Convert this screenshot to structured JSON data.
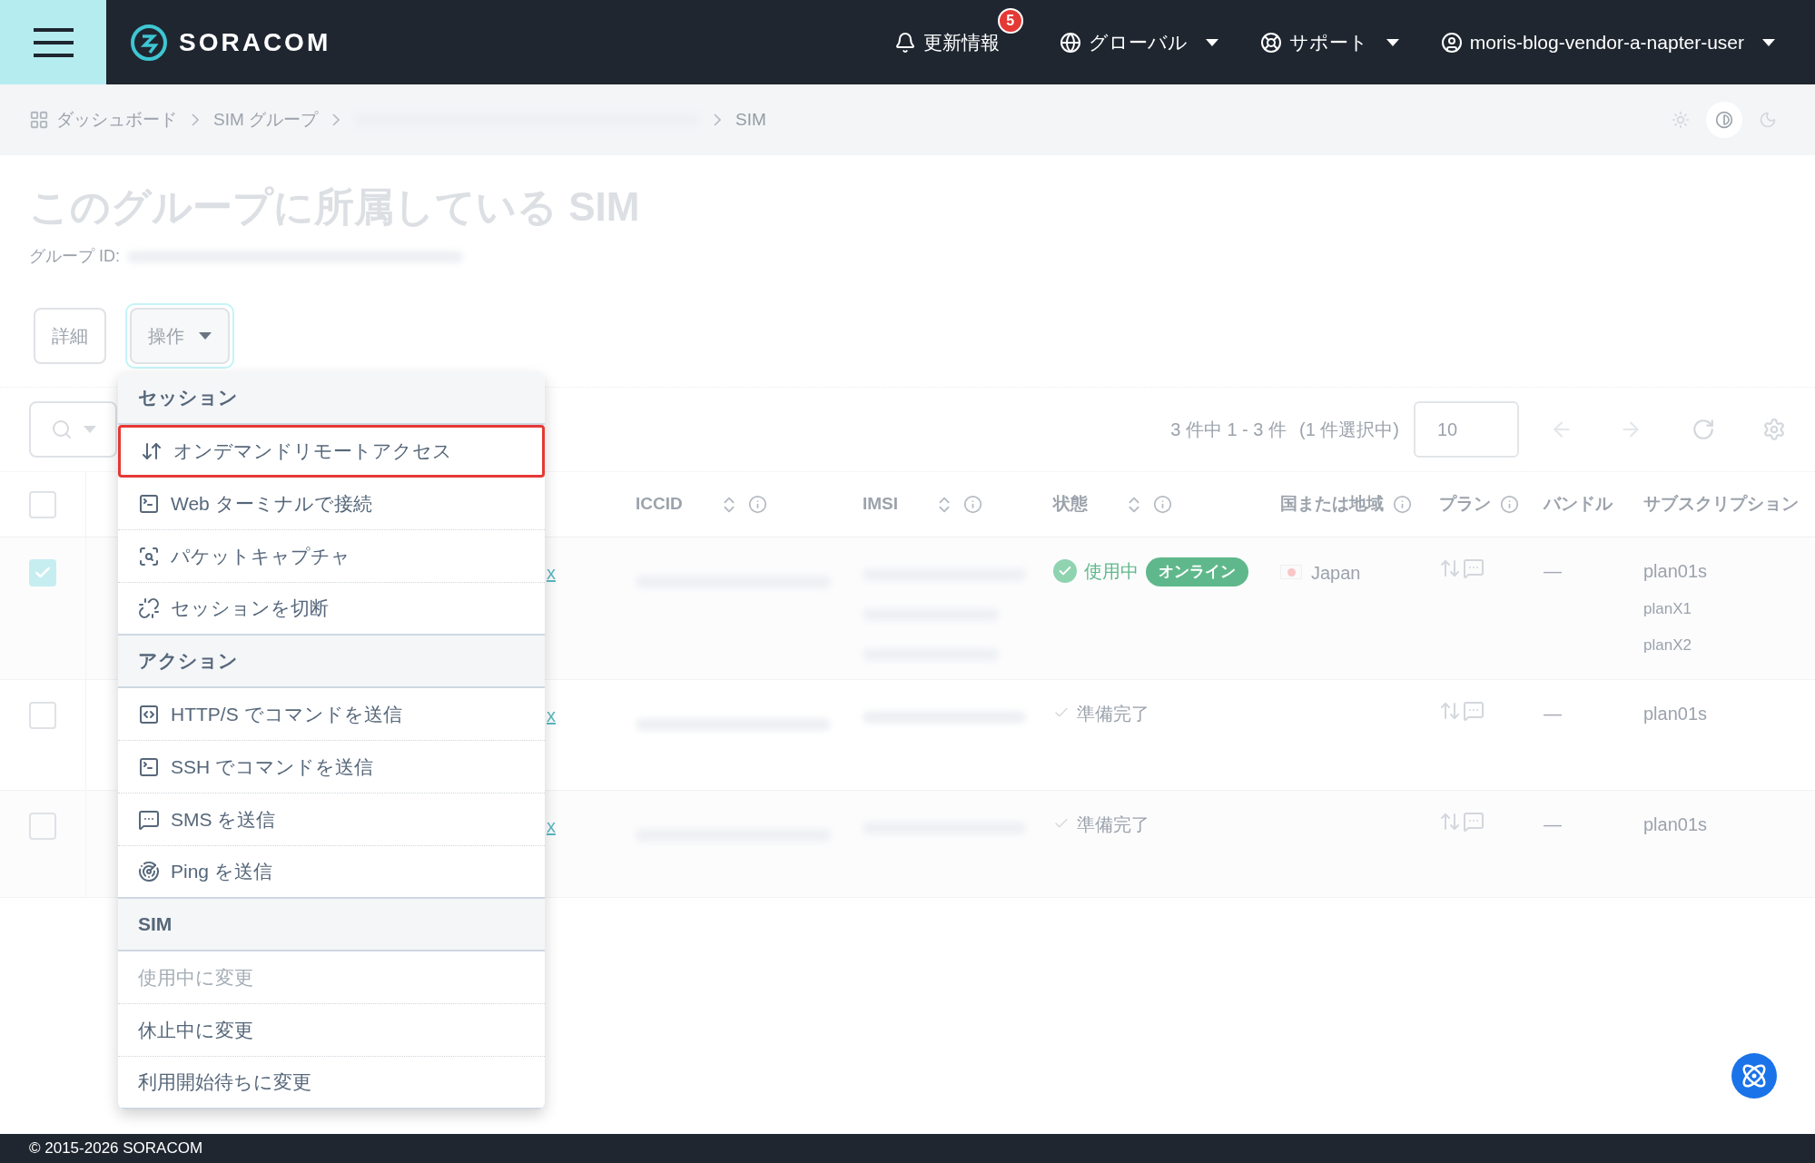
{
  "header": {
    "brand": "SORACOM",
    "notifications": {
      "label": "更新情報",
      "badge": "5"
    },
    "region": "グローバル",
    "support": "サポート",
    "user": "moris-blog-vendor-a-napter-user"
  },
  "breadcrumb": {
    "items": [
      {
        "label": "ダッシュボード",
        "kind": "home"
      },
      {
        "label": "SIM グループ",
        "kind": "link"
      },
      {
        "kind": "redacted"
      },
      {
        "label": "SIM",
        "kind": "current"
      }
    ],
    "theme_modes": [
      {
        "kind": "light",
        "selected": false
      },
      {
        "kind": "contrast",
        "selected": true
      },
      {
        "kind": "dark",
        "selected": false
      }
    ]
  },
  "page": {
    "title": "このグループに所属している SIM",
    "group_id_label": "グループ ID:"
  },
  "actions": [
    {
      "label": "詳細",
      "kind": "plain",
      "focused": false
    },
    {
      "label": "操作",
      "kind": "dropdown",
      "focused": true
    }
  ],
  "toolbar": {
    "count": "3 件中 1 - 3 件",
    "selection": "(1 件選択中)",
    "per_page": "10"
  },
  "table": {
    "select_all_checked": false,
    "columns": [
      {
        "label": "ICCID",
        "sortable": true,
        "info": true
      },
      {
        "label": "IMSI",
        "sortable": true,
        "info": true
      },
      {
        "label": "状態",
        "sortable": true,
        "info": true
      },
      {
        "label": "国または地域",
        "sortable": false,
        "info": true
      },
      {
        "label": "プラン",
        "sortable": false,
        "info": true
      },
      {
        "label": "バンドル",
        "sortable": false,
        "info": false
      },
      {
        "label": "サブスクリプション",
        "sortable": false,
        "info": false
      }
    ],
    "rows": [
      {
        "checked": true,
        "name_tail": "x",
        "status": {
          "kind": "active",
          "label": "使用中",
          "badge": "オンライン"
        },
        "country": "Japan",
        "bundle": "—",
        "subscriptions": [
          "plan01s",
          "planX1",
          "planX2"
        ]
      },
      {
        "checked": false,
        "name_tail": "x",
        "status": {
          "kind": "ready",
          "label": "準備完了"
        },
        "bundle": "—",
        "subscriptions": [
          "plan01s"
        ]
      },
      {
        "checked": false,
        "name_tail": "x",
        "status": {
          "kind": "ready",
          "label": "準備完了"
        },
        "bundle": "—",
        "subscriptions": [
          "plan01s"
        ]
      }
    ]
  },
  "menu": {
    "sections": [
      {
        "title": "セッション",
        "items": [
          {
            "label": "オンデマンドリモートアクセス",
            "kind": "remote",
            "highlighted": true,
            "disabled": false
          },
          {
            "label": "Web ターミナルで接続",
            "kind": "terminal",
            "highlighted": false,
            "disabled": false
          },
          {
            "label": "パケットキャプチャ",
            "kind": "capture",
            "highlighted": false,
            "disabled": false
          },
          {
            "label": "セッションを切断",
            "kind": "disconnect",
            "highlighted": false,
            "disabled": false
          }
        ]
      },
      {
        "title": "アクション",
        "items": [
          {
            "label": "HTTP/S でコマンドを送信",
            "kind": "http",
            "highlighted": false,
            "disabled": false
          },
          {
            "label": "SSH でコマンドを送信",
            "kind": "ssh",
            "highlighted": false,
            "disabled": false
          },
          {
            "label": "SMS を送信",
            "kind": "sms",
            "highlighted": false,
            "disabled": false
          },
          {
            "label": "Ping を送信",
            "kind": "ping",
            "highlighted": false,
            "disabled": false
          }
        ]
      },
      {
        "title": "SIM",
        "items": [
          {
            "label": "使用中に変更",
            "kind": "text",
            "highlighted": false,
            "disabled": true
          },
          {
            "label": "休止中に変更",
            "kind": "text",
            "highlighted": false,
            "disabled": false
          },
          {
            "label": "利用開始待ちに変更",
            "kind": "text",
            "highlighted": false,
            "disabled": false
          }
        ]
      }
    ]
  },
  "footer": {
    "copyright": "© 2015-2026 SORACOM"
  }
}
